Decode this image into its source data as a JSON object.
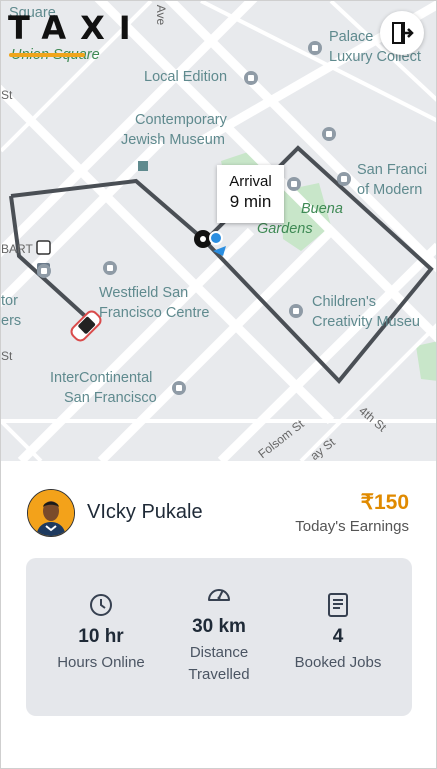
{
  "app": {
    "logo": "TAXI"
  },
  "map": {
    "labels": {
      "union_square_1": "Square",
      "union_square_2": "Union Square",
      "local_edition": "Local Edition",
      "cjm_1": "Contemporary",
      "cjm_2": "Jewish Museum",
      "palace_1": "Palace",
      "palace_2": "Luxury Collect",
      "sf_modern_1": "San Franci",
      "sf_modern_2": "of Modern",
      "yerba_1": "Buena",
      "yerba_2": "Gardens",
      "westfield_1": "Westfield San",
      "westfield_2": "Francisco Centre",
      "childrens_1": "Children's",
      "childrens_2": "Creativity Museu",
      "intercontinental_1": "InterContinental",
      "intercontinental_2": "San Francisco",
      "bart": "BART",
      "left_tor": "tor",
      "left_ers": "ers",
      "left_st": "St",
      "ave": "Ave",
      "folsom": "Folsom St",
      "fourth": "4th St",
      "howard": "ay St"
    },
    "arrival": {
      "label": "Arrival",
      "time": "9 min"
    }
  },
  "driver": {
    "name": "VIcky Pukale"
  },
  "earnings": {
    "amount": "₹150",
    "label": "Today's Earnings"
  },
  "stats": [
    {
      "icon": "clock-icon",
      "value": "10 hr",
      "label": "Hours Online"
    },
    {
      "icon": "speedometer-icon",
      "value": "30 km",
      "label_1": "Distance",
      "label_2": "Travelled"
    },
    {
      "icon": "book-icon",
      "value": "4",
      "label": "Booked Jobs"
    }
  ]
}
